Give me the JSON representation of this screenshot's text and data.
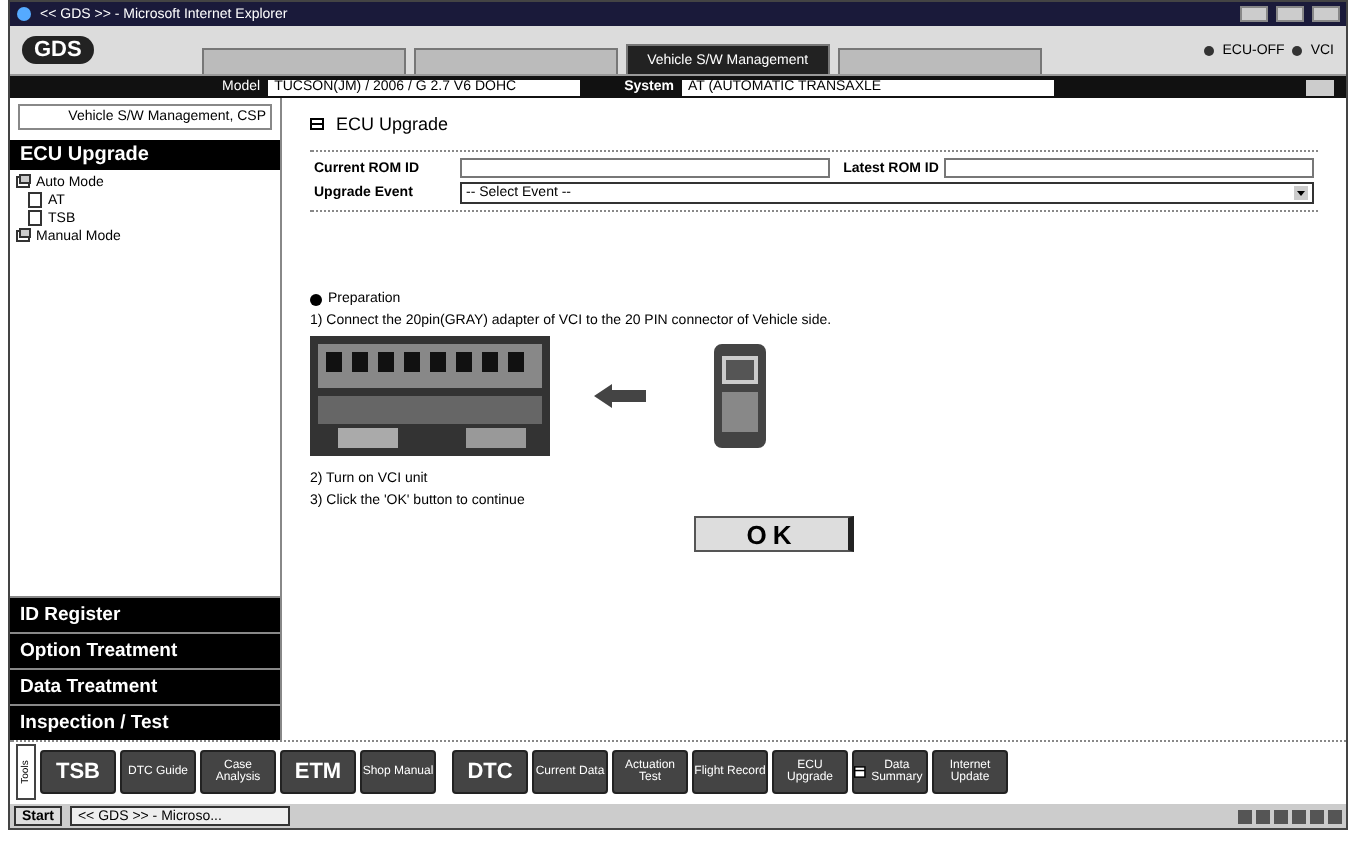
{
  "window": {
    "title": "<< GDS >> - Microsoft Internet Explorer"
  },
  "header": {
    "logo": "GDS",
    "tabs": [
      {
        "selected": false
      },
      {
        "selected": false
      },
      {
        "label": "Vehicle S/W Management",
        "selected": true
      },
      {
        "selected": false
      }
    ],
    "status": [
      {
        "label": "ECU-OFF"
      },
      {
        "label": "VCI"
      }
    ]
  },
  "vehicle_bar": {
    "model_label": "Model",
    "model": "TUCSON(JM) / 2006 / G 2.7 V6 DOHC",
    "system_label": "System",
    "system": "AT (AUTOMATIC TRANSAXLE"
  },
  "sidebar": {
    "title": "Vehicle S/W Management, CSP",
    "section": "ECU Upgrade",
    "tree": [
      {
        "label": "Auto Mode",
        "children": [
          {
            "label": "AT"
          },
          {
            "label": "TSB"
          }
        ]
      },
      {
        "label": "Manual Mode"
      }
    ],
    "menus": [
      "ID Register",
      "Option Treatment",
      "Data Treatment",
      "Inspection / Test"
    ]
  },
  "content": {
    "title": "ECU Upgrade",
    "fields": [
      {
        "label": "Current ROM ID"
      },
      {
        "label": "Latest ROM ID"
      }
    ],
    "event": {
      "label": "Upgrade Event",
      "value": "-- Select Event --"
    },
    "preparation": "Preparation",
    "steps": [
      "1) Connect the 20pin(GRAY) adapter of VCI to the 20 PIN connector of Vehicle side.",
      "2) Turn on VCI unit",
      "3) Click the 'OK' button to continue"
    ],
    "ok": "OK"
  },
  "toolbar": {
    "side_label": "Tools",
    "buttons": [
      {
        "label": "TSB",
        "kind": "large"
      },
      {
        "label": "DTC Guide",
        "kind": "small"
      },
      {
        "label": "Case Analysis",
        "kind": "small"
      },
      {
        "label": "ETM",
        "kind": "large"
      },
      {
        "label": "Shop Manual",
        "kind": "small"
      },
      {
        "label": "DTC",
        "kind": "large"
      },
      {
        "label": "Current Data",
        "kind": "small"
      },
      {
        "label": "Actuation Test",
        "kind": "small"
      },
      {
        "label": "Flight Record",
        "kind": "small"
      },
      {
        "label": "ECU Upgrade",
        "kind": "small"
      },
      {
        "label": "Data Summary",
        "kind": "icon"
      },
      {
        "label": "Internet Update",
        "kind": "small"
      }
    ]
  },
  "taskbar": {
    "start": "Start",
    "tasks": [
      {
        "label": "<< GDS >> - Microso..."
      }
    ]
  }
}
